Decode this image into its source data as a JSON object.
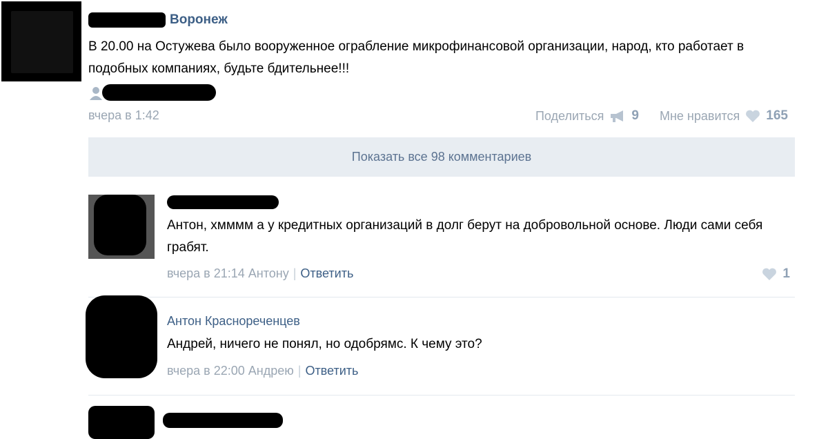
{
  "post": {
    "city": "Воронеж",
    "text": "В 20.00 на Остужева было вооруженное ограбление микрофинансовой организации, народ, кто работает в подобных компаниях, будьте бдительнее!!!",
    "date": "вчера в 1:42",
    "share_label": "Поделиться",
    "share_icon": "megaphone-icon",
    "share_count": "9",
    "like_label": "Мне нравится",
    "like_icon": "heart-icon",
    "like_count": "165"
  },
  "show_all_label": "Показать все 98 комментариев",
  "comments": [
    {
      "text": "Антон, хмммм а у кредитных организаций в долг берут на добровольной основе. Люди сами себя грабят.",
      "meta": "вчера в 21:14 Антону",
      "reply_label": "Ответить",
      "like_count": "1"
    },
    {
      "author": "Антон Краснореченцев",
      "text": "Андрей, ничего не понял, но одобрямс. К чему это?",
      "meta": "вчера в 22:00 Андрею",
      "reply_label": "Ответить"
    }
  ],
  "colors": {
    "link_blue": "#3d5f86",
    "muted_gray": "#9aa6b3",
    "button_bg": "#e8edf2"
  }
}
